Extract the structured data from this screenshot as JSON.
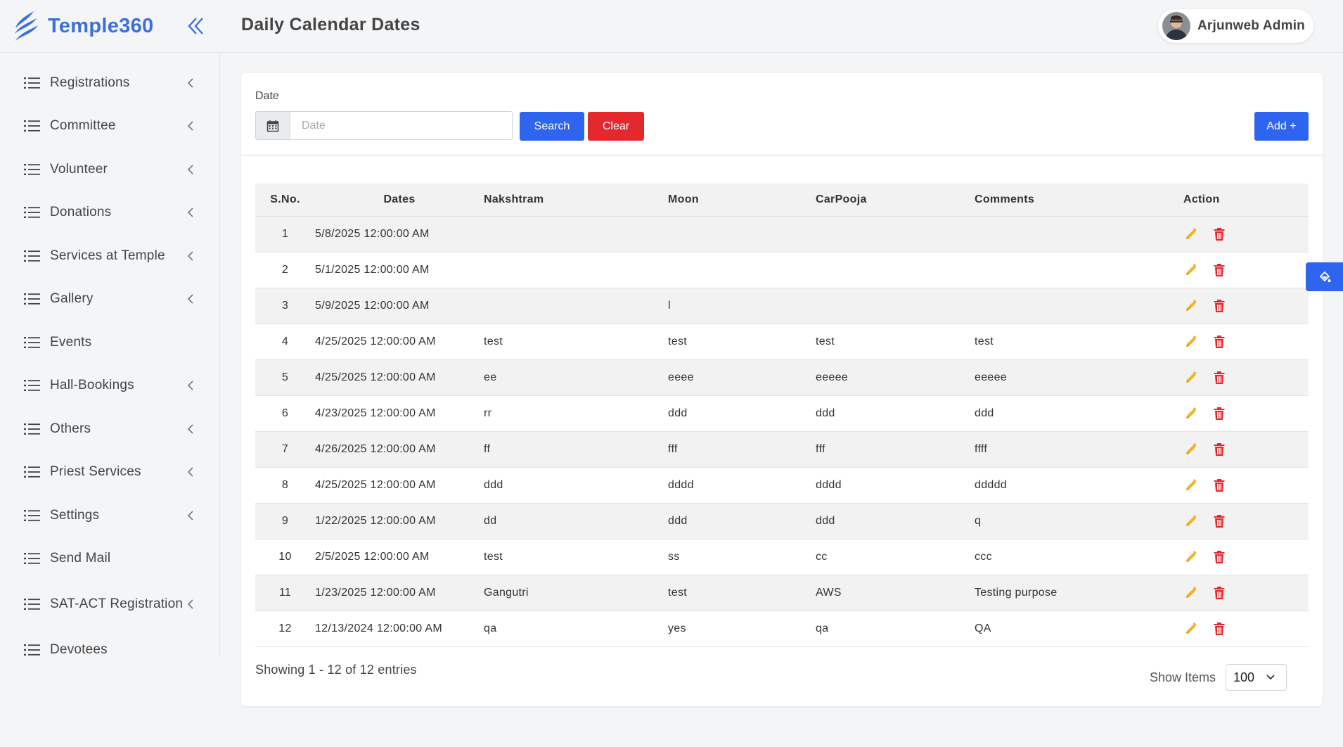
{
  "brand": {
    "name": "Temple360",
    "accent": "#3d6fdc"
  },
  "sidebar": {
    "items": [
      {
        "label": "Registrations",
        "has_submenu": true
      },
      {
        "label": "Committee",
        "has_submenu": true
      },
      {
        "label": "Volunteer",
        "has_submenu": true
      },
      {
        "label": "Donations",
        "has_submenu": true
      },
      {
        "label": "Services at Temple",
        "has_submenu": true
      },
      {
        "label": "Gallery",
        "has_submenu": true
      },
      {
        "label": "Events",
        "has_submenu": false
      },
      {
        "label": "Hall-Bookings",
        "has_submenu": true
      },
      {
        "label": "Others",
        "has_submenu": true
      },
      {
        "label": "Priest Services",
        "has_submenu": true
      },
      {
        "label": "Settings",
        "has_submenu": true
      },
      {
        "label": "Send Mail",
        "has_submenu": false
      },
      {
        "label": "SAT-ACT Registration",
        "has_submenu": true
      },
      {
        "label": "Devotees",
        "has_submenu": false
      }
    ]
  },
  "header": {
    "title": "Daily Calendar Dates",
    "user_name": "Arjunweb Admin"
  },
  "filter": {
    "label": "Date",
    "placeholder": "Date",
    "value": "",
    "search_label": "Search",
    "clear_label": "Clear",
    "add_label": "Add +"
  },
  "table": {
    "columns": [
      "S.No.",
      "Dates",
      "Nakshtram",
      "Moon",
      "CarPooja",
      "Comments",
      "Action"
    ],
    "rows": [
      {
        "sno": "1",
        "date": "5/8/2025 12:00:00 AM",
        "nakshtram": "",
        "moon": "",
        "carpooja": "",
        "comments": ""
      },
      {
        "sno": "2",
        "date": "5/1/2025 12:00:00 AM",
        "nakshtram": "",
        "moon": "",
        "carpooja": "",
        "comments": ""
      },
      {
        "sno": "3",
        "date": "5/9/2025 12:00:00 AM",
        "nakshtram": "",
        "moon": "l",
        "carpooja": "",
        "comments": ""
      },
      {
        "sno": "4",
        "date": "4/25/2025 12:00:00 AM",
        "nakshtram": "test",
        "moon": "test",
        "carpooja": "test",
        "comments": "test"
      },
      {
        "sno": "5",
        "date": "4/25/2025 12:00:00 AM",
        "nakshtram": "ee",
        "moon": "eeee",
        "carpooja": "eeeee",
        "comments": "eeeee"
      },
      {
        "sno": "6",
        "date": "4/23/2025 12:00:00 AM",
        "nakshtram": "rr",
        "moon": "ddd",
        "carpooja": "ddd",
        "comments": "ddd"
      },
      {
        "sno": "7",
        "date": "4/26/2025 12:00:00 AM",
        "nakshtram": "ff",
        "moon": "fff",
        "carpooja": "fff",
        "comments": "ffff"
      },
      {
        "sno": "8",
        "date": "4/25/2025 12:00:00 AM",
        "nakshtram": "ddd",
        "moon": "dddd",
        "carpooja": "dddd",
        "comments": "ddddd"
      },
      {
        "sno": "9",
        "date": "1/22/2025 12:00:00 AM",
        "nakshtram": "dd",
        "moon": "ddd",
        "carpooja": "ddd",
        "comments": "q"
      },
      {
        "sno": "10",
        "date": "2/5/2025 12:00:00 AM",
        "nakshtram": "test",
        "moon": "ss",
        "carpooja": "cc",
        "comments": "ccc"
      },
      {
        "sno": "11",
        "date": "1/23/2025 12:00:00 AM",
        "nakshtram": "Gangutri",
        "moon": "test",
        "carpooja": "AWS",
        "comments": "Testing purpose"
      },
      {
        "sno": "12",
        "date": "12/13/2024 12:00:00 AM",
        "nakshtram": "qa",
        "moon": "yes",
        "carpooja": "qa",
        "comments": "QA"
      }
    ]
  },
  "footer": {
    "entries_info": "Showing 1 - 12 of 12 entries",
    "show_items_label": "Show Items",
    "show_items_value": "100"
  },
  "icons": {
    "edit": "pencil-icon",
    "delete": "trash-icon",
    "calendar": "calendar-icon",
    "nav": "list-icon",
    "float": "paint-bucket-icon"
  },
  "colors": {
    "primary": "#2f64ee",
    "danger": "#e3282e",
    "edit_icon": "#f0b323",
    "delete_icon": "#e3282e"
  }
}
